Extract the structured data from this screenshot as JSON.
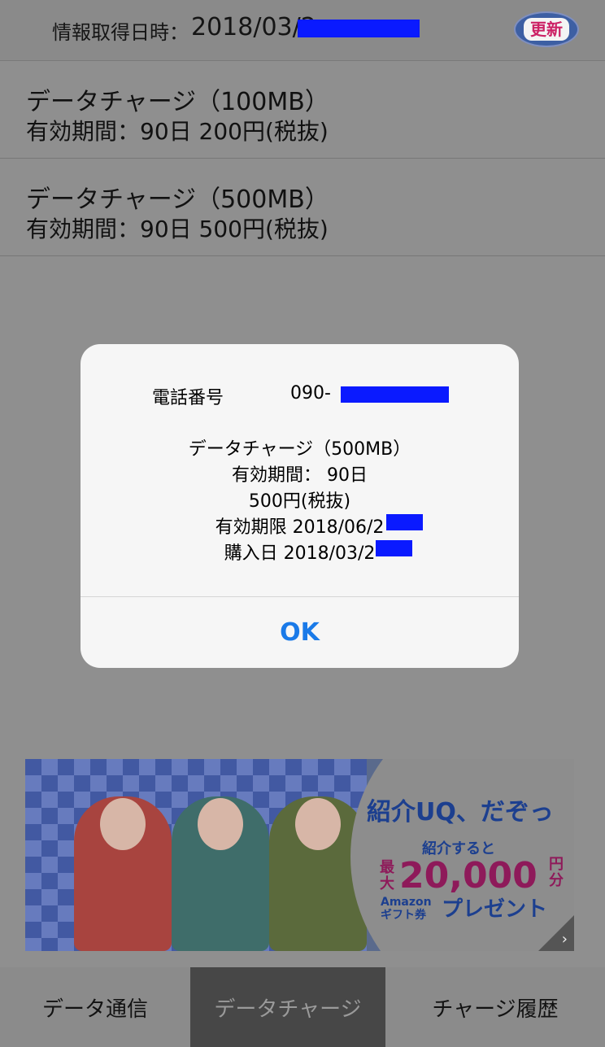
{
  "header": {
    "label": "情報取得日時：",
    "datetime": "2018/03/2",
    "refresh_label": "更新"
  },
  "charges": [
    {
      "name": "データチャージ（100MB）",
      "detail": "有効期間：90日  200円(税抜)"
    },
    {
      "name": "データチャージ（500MB）",
      "detail": "有効期間：90日  500円(税抜)"
    }
  ],
  "dialog": {
    "phone_label": "電話番号",
    "phone_value": "090-",
    "plan": "データチャージ（500MB）",
    "period": "有効期間： 90日",
    "price": "500円(税抜)",
    "expiry": "有効期限 2018/06/2",
    "purchase": "購入日 2018/03/2",
    "ok_label": "OK"
  },
  "banner": {
    "headline": "紹介UQ、だぞっ",
    "sub": "紹介すると",
    "max": "最大",
    "amount": "20,000",
    "yen": "円分",
    "amazon": "Amazon ギフト券",
    "present": "プレゼント"
  },
  "tabs": [
    {
      "label": "データ通信"
    },
    {
      "label": "データチャージ"
    },
    {
      "label": "チャージ履歴"
    }
  ],
  "colors": {
    "redaction": "#0a1aff",
    "ok_blue": "#1a7ae8",
    "active_tab": "#474747"
  }
}
